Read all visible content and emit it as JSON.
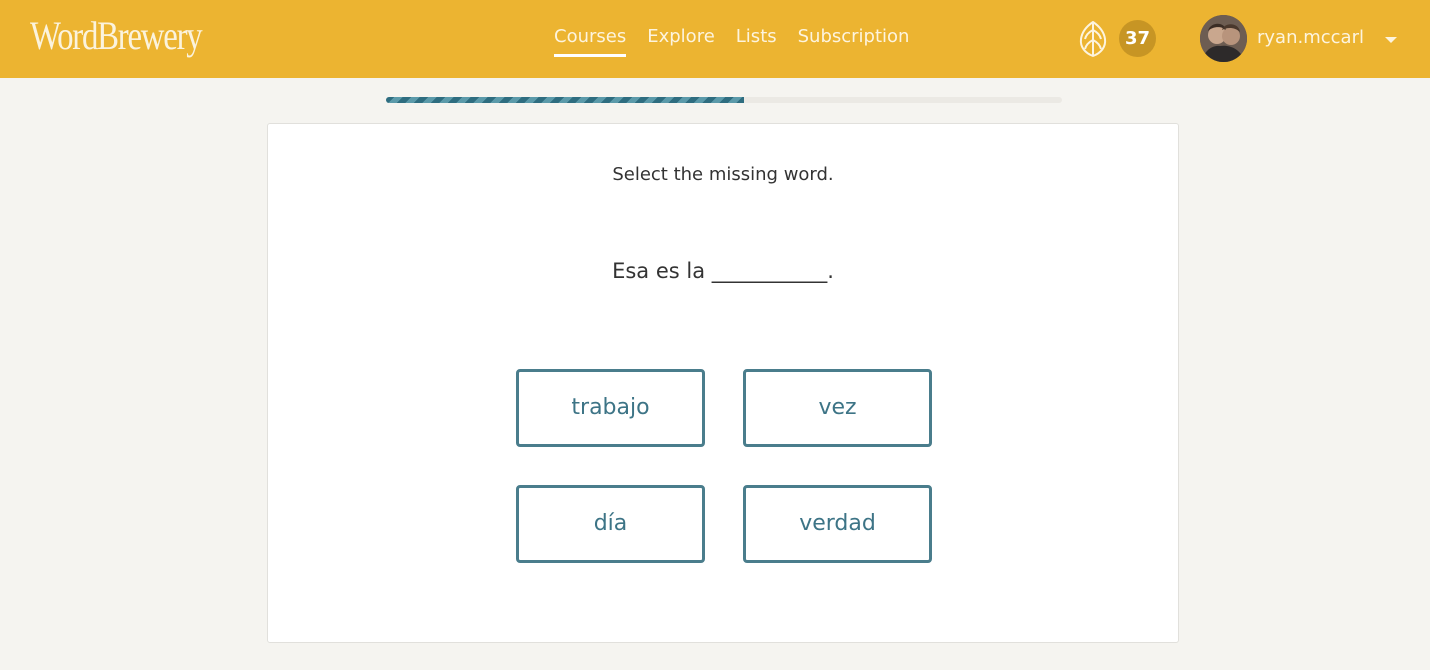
{
  "header": {
    "logo": "WordBrewery",
    "nav": [
      {
        "label": "Courses",
        "active": true
      },
      {
        "label": "Explore",
        "active": false
      },
      {
        "label": "Lists",
        "active": false
      },
      {
        "label": "Subscription",
        "active": false
      }
    ],
    "points_icon": "hop-icon",
    "points": "37",
    "username": "ryan.mccarl",
    "menu_icon": "caret-down-icon"
  },
  "progress": {
    "fraction": 0.53,
    "accent": "#2e6d80"
  },
  "exercise": {
    "instruction": "Select the missing word.",
    "sentence": "Esa es la ___________.",
    "choices": [
      "trabajo",
      "vez",
      "día",
      "verdad"
    ]
  },
  "colors": {
    "header_bg": "#ecb431",
    "page_bg": "#f5f4f0",
    "choice_border": "#4a7d8c",
    "badge_bg": "#c79524"
  }
}
